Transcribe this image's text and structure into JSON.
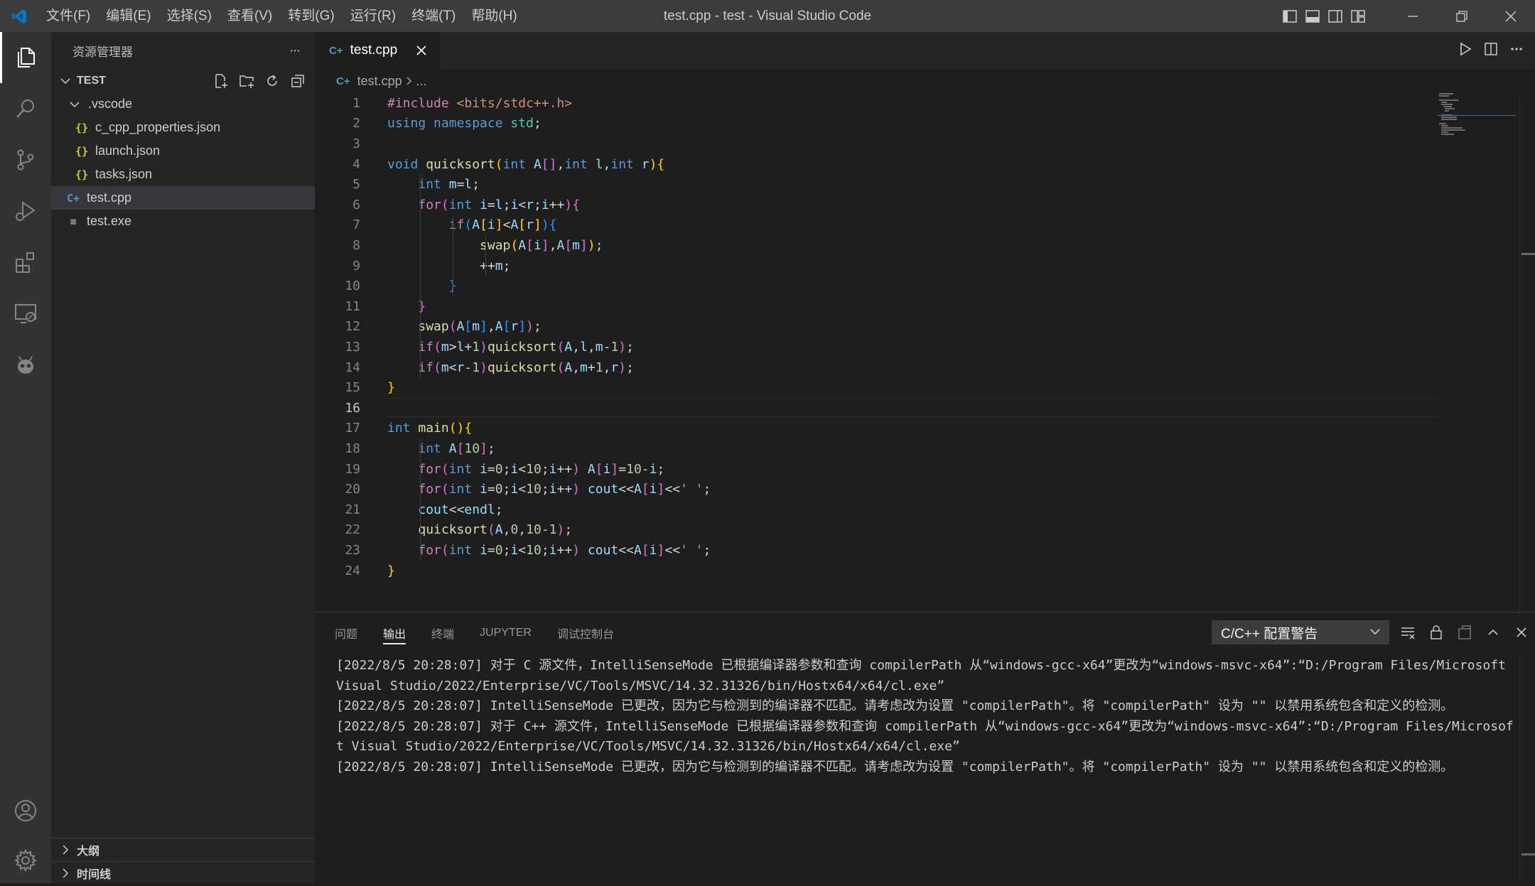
{
  "titlebar": {
    "menus": [
      "文件(F)",
      "编辑(E)",
      "选择(S)",
      "查看(V)",
      "转到(G)",
      "运行(R)",
      "终端(T)",
      "帮助(H)"
    ],
    "window_title": "test.cpp - test - Visual Studio Code",
    "accent": "#0078d4"
  },
  "sidebar": {
    "header": "资源管理器",
    "more": "···",
    "folder": "TEST",
    "tree": [
      {
        "label": ".vscode",
        "type": "folder"
      },
      {
        "label": "c_cpp_properties.json",
        "type": "json",
        "icon": "{}"
      },
      {
        "label": "launch.json",
        "type": "json",
        "icon": "{}"
      },
      {
        "label": "tasks.json",
        "type": "json",
        "icon": "{}"
      },
      {
        "label": "test.cpp",
        "type": "cpp",
        "icon": "C+"
      },
      {
        "label": "test.exe",
        "type": "exe",
        "icon": "≡"
      }
    ],
    "outline": "大纲",
    "timeline": "时间线"
  },
  "editor": {
    "tab_label": "test.cpp",
    "breadcrumb_file": "test.cpp",
    "breadcrumb_rest": "...",
    "current_line": 16
  },
  "panel": {
    "tabs": [
      "问题",
      "输出",
      "终端",
      "JUPYTER",
      "调试控制台"
    ],
    "active_tab": "输出",
    "selected_channel": "C/C++ 配置警告",
    "output": "[2022/8/5 20:28:07] 对于 C 源文件，IntelliSenseMode 已根据编译器参数和查询 compilerPath 从“windows-gcc-x64”更改为“windows-msvc-x64”:“D:/Program Files/Microsoft Visual Studio/2022/Enterprise/VC/Tools/MSVC/14.32.31326/bin/Hostx64/x64/cl.exe”\n[2022/8/5 20:28:07] IntelliSenseMode 已更改，因为它与检测到的编译器不匹配。请考虑改为设置 \"compilerPath\"。将 \"compilerPath\" 设为 \"\" 以禁用系统包含和定义的检测。\n[2022/8/5 20:28:07] 对于 C++ 源文件，IntelliSenseMode 已根据编译器参数和查询 compilerPath 从“windows-gcc-x64”更改为“windows-msvc-x64”:“D:/Program Files/Microsoft Visual Studio/2022/Enterprise/VC/Tools/MSVC/14.32.31326/bin/Hostx64/x64/cl.exe”\n[2022/8/5 20:28:07] IntelliSenseMode 已更改，因为它与检测到的编译器不匹配。请考虑改为设置 \"compilerPath\"。将 \"compilerPath\" 设为 \"\" 以禁用系统包含和定义的检测。"
  },
  "code_lines": [
    "#include <bits/stdc++.h>",
    "using namespace std;",
    "",
    "void quicksort(int A[],int l,int r){",
    "    int m=l;",
    "    for(int i=l;i<r;i++){",
    "        if(A[i]<A[r]){",
    "            swap(A[i],A[m]);",
    "            ++m;",
    "        }",
    "    }",
    "    swap(A[m],A[r]);",
    "    if(m>l+1)quicksort(A,l,m-1);",
    "    if(m<r-1)quicksort(A,m+1,r);",
    "}",
    "",
    "int main(){",
    "    int A[10];",
    "    for(int i=0;i<10;i++) A[i]=10-i;",
    "    for(int i=0;i<10;i++) cout<<A[i]<<' ';",
    "    cout<<endl;",
    "    quicksort(A,0,10-1);",
    "    for(int i=0;i<10;i++) cout<<A[i]<<' ';",
    "}"
  ]
}
